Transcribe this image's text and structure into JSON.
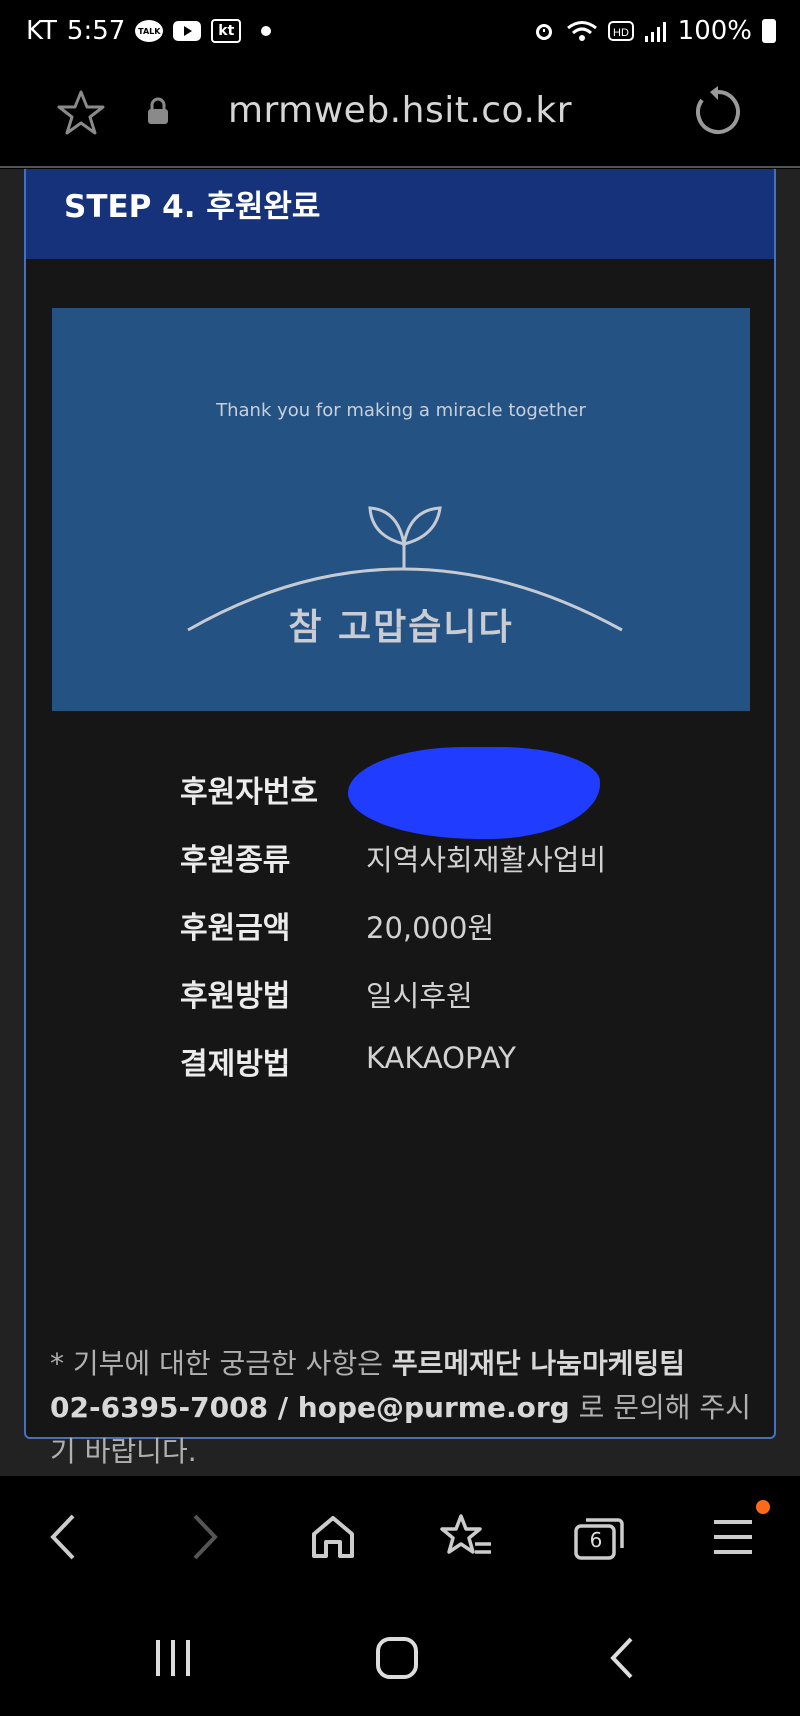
{
  "status": {
    "carrier": "KT",
    "time": "5:57",
    "battery": "100%",
    "notif_icons": [
      "talk-icon",
      "youtube-icon",
      "kt-icon"
    ],
    "sys_icons": [
      "alarm-icon",
      "wifi-icon",
      "hd-icon",
      "signal-icon",
      "battery-icon"
    ]
  },
  "browser": {
    "url": "mrmweb.hsit.co.kr",
    "tab_count": "6"
  },
  "page": {
    "step_title": "STEP 4. 후원완료",
    "banner": {
      "en": "Thank you for making a miracle together",
      "ko": "참 고맙습니다"
    },
    "info": [
      {
        "label": "후원자번호",
        "value": ""
      },
      {
        "label": "후원종류",
        "value": "지역사회재활사업비"
      },
      {
        "label": "후원금액",
        "value": "20,000원"
      },
      {
        "label": "후원방법",
        "value": "일시후원"
      },
      {
        "label": "결제방법",
        "value": "KAKAOPAY"
      }
    ],
    "footnote": {
      "prefix": "* 기부에 대한 궁금한 사항은 ",
      "team": "푸르메재단 나눔마케팅팀",
      "contact": "02-6395-7008 / hope@purme.org",
      "suffix": " 로 문의해 주시기 바랍니다."
    }
  },
  "colors": {
    "header": "#15327a",
    "banner": "#235283",
    "card_border": "#4470c0",
    "redaction": "#1f3cff",
    "badge": "#ff6a1a"
  }
}
